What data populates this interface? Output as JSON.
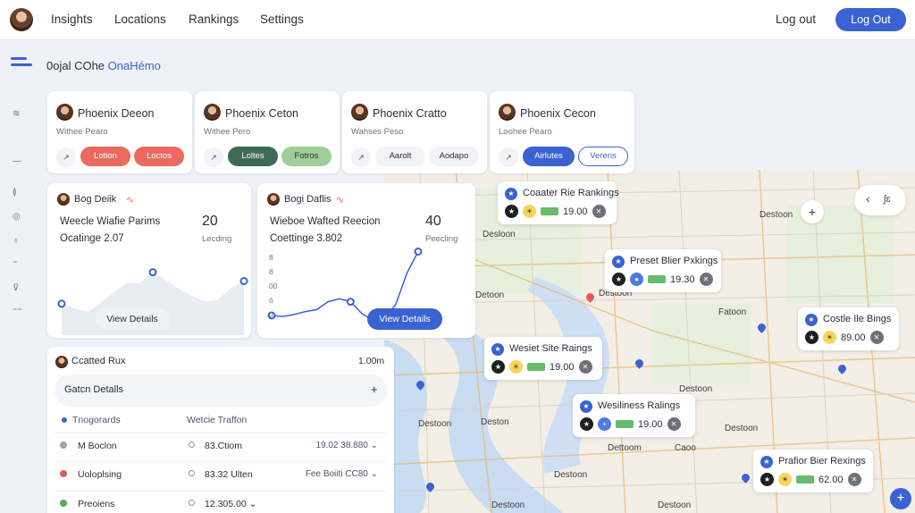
{
  "nav": {
    "links": [
      "Insights",
      "Locations",
      "Rankings",
      "Settings"
    ],
    "logout_text": "Log out",
    "logout_button": "Log Out"
  },
  "header": {
    "title_part1": "0ojal COhe ",
    "title_part2": "OnaHémo"
  },
  "rail": [
    "≋",
    "—",
    "≬",
    "◎",
    "♁",
    "⁼",
    "⊽",
    "⁼⁼"
  ],
  "profiles": [
    {
      "name": "Phoenix Deeon",
      "subtitle": "Withee Pearo",
      "btn1": "Lotion",
      "btn2": "Loctos"
    },
    {
      "name": "Phoenix Ceton",
      "subtitle": "Withee Pero",
      "btn1": "Loltes",
      "btn2": "Fotros"
    },
    {
      "name": "Phoenix Cratto",
      "subtitle": "Wahses Peso",
      "btn1": "Aarolt",
      "btn2": "Aodapo"
    },
    {
      "name": "Phoenix Cecon",
      "subtitle": "Loohee Pearo",
      "btn1": "Airlutes",
      "btn2": "Verens"
    }
  ],
  "charts": [
    {
      "name": "Bog Deiik",
      "title": "Weecle Wiafie Parims",
      "subtitle": "Ocatinge 2.07",
      "big": "20",
      "small": "Lecding",
      "button": "View Details",
      "chart_data": {
        "type": "area",
        "values": [
          0.68,
          0.73,
          0.76,
          0.67,
          0.56,
          0.47,
          0.47,
          0.36,
          0.44,
          0.53,
          0.6,
          0.66,
          0.64,
          0.52,
          0.45
        ]
      }
    },
    {
      "name": "Bogi Daflis",
      "title": "Wieboe Wafted Reecion",
      "subtitle": "Coettinge 3.802",
      "big": "40",
      "small": "Peecling",
      "button": "View Details",
      "yticks": [
        "8",
        "8",
        "00",
        "ō",
        "0"
      ],
      "chart_data": {
        "type": "line",
        "values": [
          0.8,
          0.81,
          0.79,
          0.76,
          0.74,
          0.66,
          0.63,
          0.66,
          0.78,
          0.85,
          0.83,
          0.69,
          0.37,
          0.15
        ]
      }
    }
  ],
  "table": {
    "title": "Ccatted Rux",
    "value": "1.00m",
    "bar_label": "Gatcn Detalls",
    "bar_plus": "+",
    "header_left": "Tnogorards",
    "header_right": "Wetcie Traffon",
    "rows": [
      {
        "name": "M Boclon",
        "value": "83.Ctiom",
        "right": "19.02 38.880 ⌄",
        "color": "#9aa3b2"
      },
      {
        "name": "Uoloplsing",
        "value": "83.32 Ulten",
        "right": "Fee Boiiti CC80 ⌄",
        "color": "#e45b5b"
      },
      {
        "name": "Preoiens",
        "value": "12.305.00 ⌄",
        "right": "",
        "color": "#4caf50"
      }
    ]
  },
  "map": {
    "labels": [
      "Destoon",
      "Desloon",
      "Detoon",
      "Fatoon",
      "Destoon",
      "Destoon",
      "Deston",
      "Destoon",
      "Destoon",
      "Dettoom",
      "Caoo",
      "Destoon",
      "Destoon",
      "Destoon",
      "Destoon",
      "Destoon",
      "Destoon"
    ],
    "zoom_left": "‹",
    "zoom_right": "ʃɛ",
    "plus": "+",
    "fab": "+",
    "cards": [
      {
        "title": "Coaater Rie Rankings",
        "value": "19.00",
        "dots": [
          "mc-dark",
          "mc-yellow"
        ]
      },
      {
        "title": "Preset Blier Pxkings",
        "value": "19.30",
        "dots": [
          "mc-dark",
          "mc-blue"
        ]
      },
      {
        "title": "Wesiet Site Raings",
        "value": "19.00",
        "dots": [
          "mc-dark",
          "mc-yellow"
        ]
      },
      {
        "title": "Costle Ile Bings",
        "value": "89.00",
        "dots": [
          "mc-dark",
          "mc-yellow"
        ]
      },
      {
        "title": "Wesiliness Ralings",
        "value": "19.00",
        "dots": [
          "mc-dark",
          "mc-blue"
        ]
      },
      {
        "title": "Prafior Bier Rexings",
        "value": "62.00",
        "dots": [
          "mc-dark",
          "mc-yellow"
        ]
      }
    ]
  },
  "colors": {
    "accent": "#3a63d1",
    "coral": "#ea6a5f",
    "dark_green": "#3e6b54",
    "light_green": "#9fce9a"
  }
}
